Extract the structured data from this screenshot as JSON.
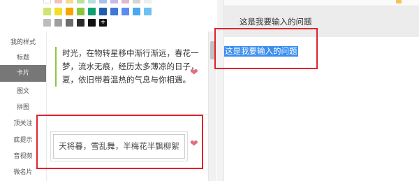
{
  "palette": {
    "rows": [
      [
        "#ffffff",
        "#f6c0c0",
        "#f5d98f",
        "#b7e0a7",
        "#b4e0dd",
        "#a7c2e8",
        "#c9b9e6",
        "#e3b7d1",
        "#d5d5d5",
        "#eeeeee"
      ],
      [
        "#cfe66e",
        "#f3df2a",
        "#f7a400",
        "#8cc63f",
        "#10a070",
        "#1f5fa8",
        "#3f78d6",
        "#5b8cf0",
        "#4aa8f0",
        "#6ec0f5"
      ],
      [
        "#bdbdbd",
        "#9e9e9e",
        "#6d6d6d",
        "#2b2b2b",
        "#111111"
      ]
    ],
    "add_label": "+"
  },
  "sidebar": {
    "items": [
      {
        "label": "我的样式"
      },
      {
        "label": "标题"
      },
      {
        "label": "卡片"
      },
      {
        "label": "图文"
      },
      {
        "label": "拼图"
      },
      {
        "label": "顶关注"
      },
      {
        "label": "底提示"
      },
      {
        "label": "音视频"
      },
      {
        "label": "微名片"
      }
    ]
  },
  "cards": {
    "card1_text": "时光，在物转星移中渐行渐远，春花一梦，流水无痕，经历太多薄凉的日子，夏，依旧带着温热的气息与你相遇。",
    "card2_text": "天将暮，雪乱舞，半梅花半飘柳絮"
  },
  "editor": {
    "question_text": "这是我要输入的问题",
    "selected_text": "这是我要输入的问题"
  },
  "colors": {
    "active_sidebar": "#777777",
    "card_accent": "#8cc63f",
    "heart": "#e0707a",
    "highlight": "#e0232c",
    "selection": "#3b8ef0"
  }
}
